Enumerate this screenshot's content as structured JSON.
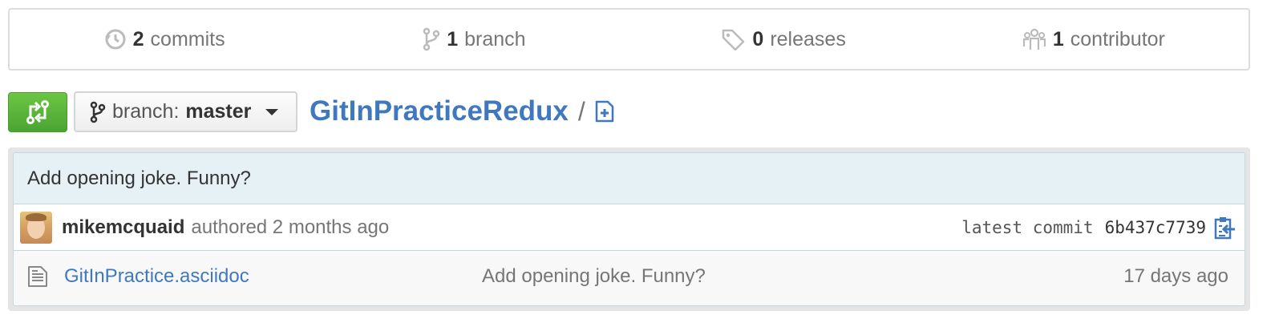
{
  "summary": {
    "commits": {
      "count": "2",
      "label": "commits",
      "icon": "history-icon"
    },
    "branches": {
      "count": "1",
      "label": "branch",
      "icon": "git-branch-icon"
    },
    "releases": {
      "count": "0",
      "label": "releases",
      "icon": "tag-icon"
    },
    "contributors": {
      "count": "1",
      "label": "contributor",
      "icon": "organization-icon"
    }
  },
  "branch_select": {
    "prefix": "branch:",
    "current": "master"
  },
  "repo": {
    "name": "GitInPractice",
    "name_suffix": "Redux",
    "separator": "/"
  },
  "commit": {
    "message": "Add opening joke. Funny?",
    "author": "mikemcquaid",
    "authored_text": "authored 2 months ago",
    "latest_label": "latest commit",
    "sha": "6b437c7739"
  },
  "files": [
    {
      "name": "GitInPractice.asciidoc",
      "message": "Add opening joke. Funny?",
      "age": "17 days ago"
    }
  ],
  "colors": {
    "accent": "#4078c0",
    "compare_button": "#6cc644",
    "commit_header": "#e6f1f6"
  }
}
